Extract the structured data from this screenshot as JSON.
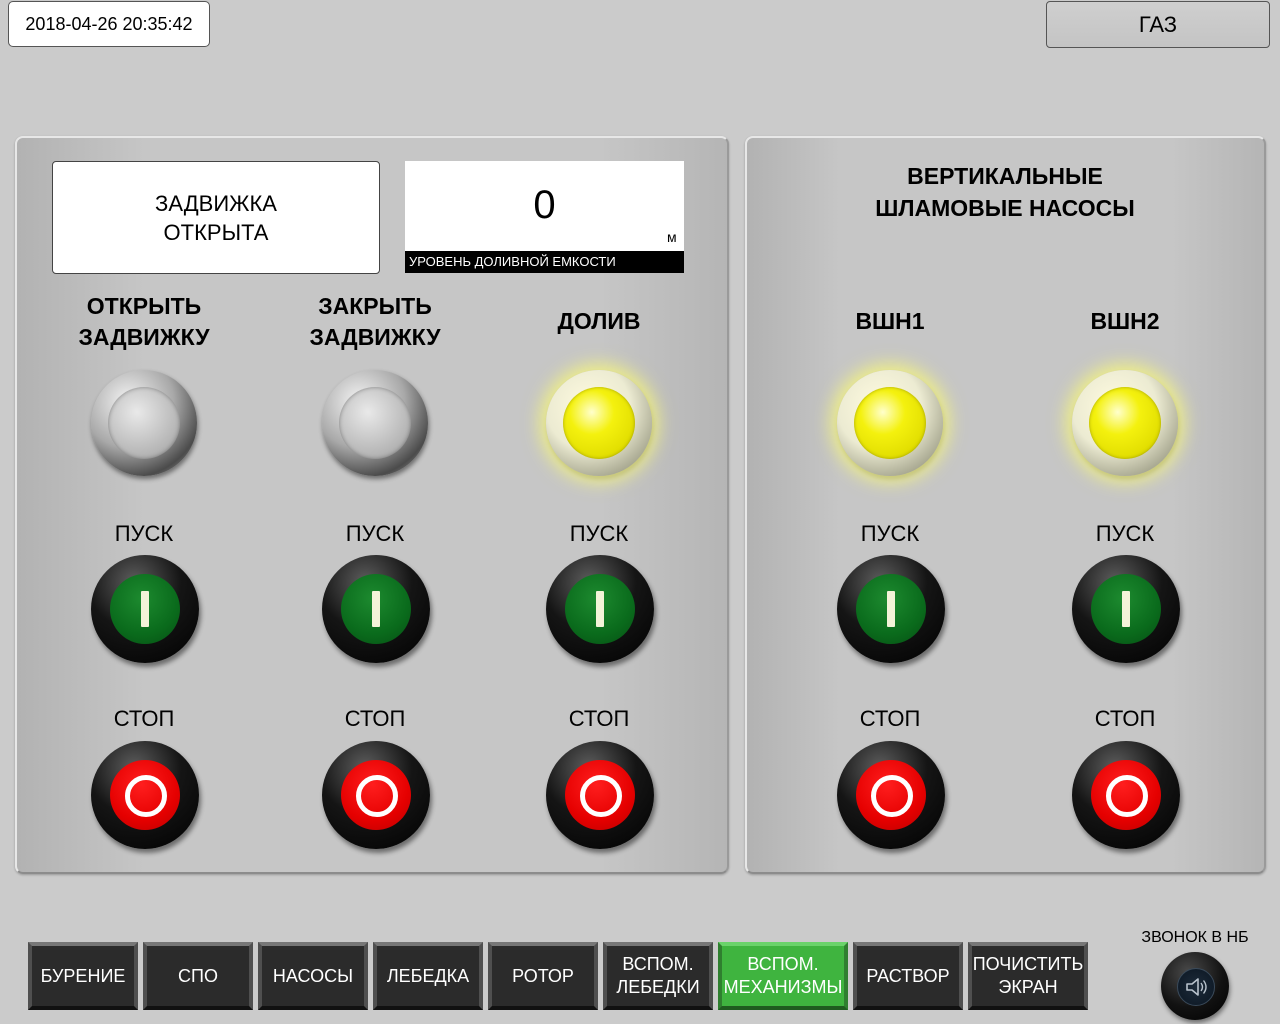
{
  "header": {
    "datetime": "2018-04-26 20:35:42",
    "gas_button_label": "ГАЗ"
  },
  "left_panel": {
    "valve_status_line1": "ЗАДВИЖКА",
    "valve_status_line2": "ОТКРЫТА",
    "level": {
      "value": "0",
      "unit": "м",
      "caption": "УРОВЕНЬ ДОЛИВНОЙ ЕМКОСТИ"
    },
    "columns": [
      {
        "title_line1": "ОТКРЫТЬ",
        "title_line2": "ЗАДВИЖКУ",
        "lamp": "off",
        "start_label": "ПУСК",
        "stop_label": "СТОП"
      },
      {
        "title_line1": "ЗАКРЫТЬ",
        "title_line2": "ЗАДВИЖКУ",
        "lamp": "off",
        "start_label": "ПУСК",
        "stop_label": "СТОП"
      },
      {
        "title_line1": "ДОЛИВ",
        "title_line2": "",
        "lamp": "on",
        "start_label": "ПУСК",
        "stop_label": "СТОП"
      }
    ]
  },
  "right_panel": {
    "title_line1": "ВЕРТИКАЛЬНЫЕ",
    "title_line2": "ШЛАМОВЫЕ НАСОСЫ",
    "columns": [
      {
        "title": "ВШН1",
        "lamp": "on",
        "start_label": "ПУСК",
        "stop_label": "СТОП"
      },
      {
        "title": "ВШН2",
        "lamp": "on",
        "start_label": "ПУСК",
        "stop_label": "СТОП"
      }
    ]
  },
  "nav": {
    "items": [
      {
        "label_line1": "БУРЕНИЕ",
        "label_line2": ""
      },
      {
        "label_line1": "СПО",
        "label_line2": ""
      },
      {
        "label_line1": "НАСОСЫ",
        "label_line2": ""
      },
      {
        "label_line1": "ЛЕБЕДКА",
        "label_line2": ""
      },
      {
        "label_line1": "РОТОР",
        "label_line2": ""
      },
      {
        "label_line1": "ВСПОМ.",
        "label_line2": "ЛЕБЕДКИ"
      },
      {
        "label_line1": "ВСПОМ.",
        "label_line2": "МЕХАНИЗМЫ"
      },
      {
        "label_line1": "РАСТВОР",
        "label_line2": ""
      },
      {
        "label_line1": "ПОЧИСТИТЬ",
        "label_line2": "ЭКРАН"
      }
    ],
    "active_index": 6
  },
  "bell": {
    "label": "ЗВОНОК В НБ",
    "icon": "speaker-icon"
  },
  "colors": {
    "lamp_on": "#f4f10e",
    "start_green": "#0a6b1c",
    "stop_red": "#e50000",
    "nav_active": "#3fb43f"
  }
}
